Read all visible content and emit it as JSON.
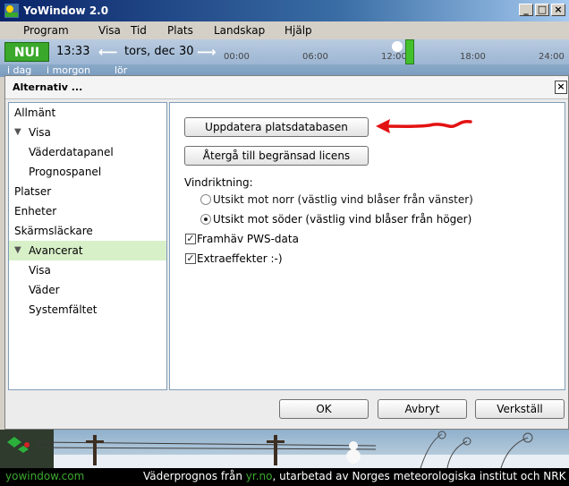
{
  "app": {
    "title": "YoWindow 2.0",
    "min_label": "_",
    "max_label": "□",
    "close_label": "×"
  },
  "menu": [
    "Program",
    "Visa",
    "Tid",
    "Plats",
    "Landskap",
    "Hjälp"
  ],
  "timeline": {
    "now_label": "NUI",
    "time": "13:33",
    "date": "tors, dec 30",
    "hours": [
      "00:00",
      "06:00",
      "12:00",
      "18:00",
      "24:00"
    ],
    "tabs": [
      "i dag",
      "i morgon",
      "lör"
    ]
  },
  "dialog": {
    "title": "Alternativ ...",
    "close_label": "×",
    "tree": [
      {
        "label": "Allmänt",
        "level": 0
      },
      {
        "label": "Visa",
        "level": 0,
        "expanded": true
      },
      {
        "label": "Väderdatapanel",
        "level": 1
      },
      {
        "label": "Prognospanel",
        "level": 1
      },
      {
        "label": "Platser",
        "level": 0
      },
      {
        "label": "Enheter",
        "level": 0
      },
      {
        "label": "Skärmsläckare",
        "level": 0
      },
      {
        "label": "Avancerat",
        "level": 0,
        "expanded": true,
        "selected": true
      },
      {
        "label": "Visa",
        "level": 1
      },
      {
        "label": "Väder",
        "level": 1
      },
      {
        "label": "Systemfältet",
        "level": 1
      }
    ],
    "buttons": {
      "update_db": "Uppdatera platsdatabasen",
      "revert_license": "Återgå till begränsad licens"
    },
    "wind_direction": {
      "label": "Vindriktning:",
      "options": [
        {
          "label": "Utsikt mot norr (västlig vind blåser från vänster)",
          "selected": false
        },
        {
          "label": "Utsikt mot söder (västlig vind blåser från höger)",
          "selected": true
        }
      ]
    },
    "checkboxes": [
      {
        "label": "Framhäv PWS-data",
        "checked": true
      },
      {
        "label": "Extraeffekter  :-)",
        "checked": true
      }
    ],
    "footer_buttons": {
      "ok": "OK",
      "cancel": "Avbryt",
      "apply": "Verkställ"
    }
  },
  "footer": {
    "site": "yowindow.com",
    "credit_prefix": "Väderprognos från ",
    "credit_source": "yr.no",
    "credit_suffix": ", utarbetad av Norges meteorologiska institut och NRK"
  },
  "colors": {
    "accent_green": "#3aa82b",
    "annotation_arrow": "#e31212",
    "selected_row": "#d8f0c8"
  }
}
